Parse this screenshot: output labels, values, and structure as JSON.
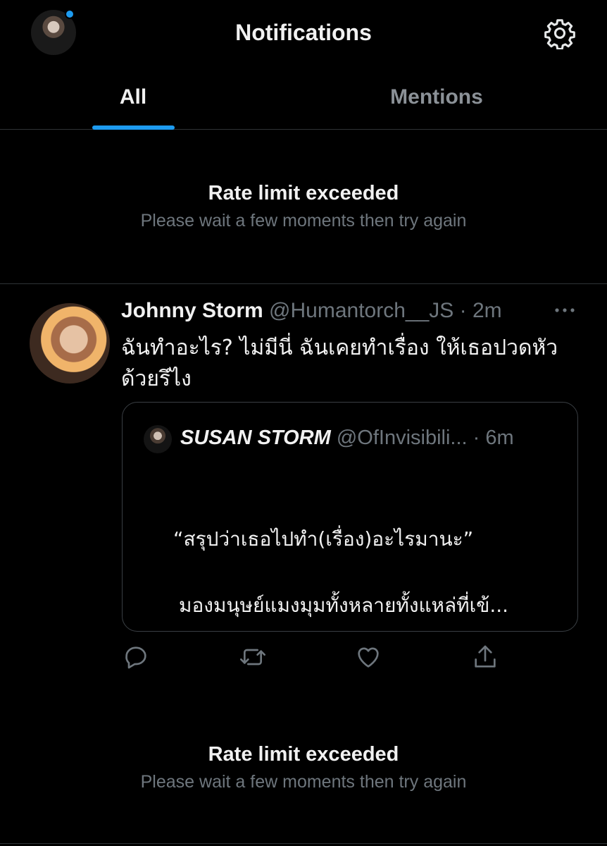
{
  "header": {
    "title": "Notifications",
    "avatar_icon": "profile-avatar",
    "settings_icon": "gear-icon"
  },
  "tabs": [
    {
      "label": "All",
      "selected": true
    },
    {
      "label": "Mentions",
      "selected": false
    }
  ],
  "rate_limit_top": {
    "title": "Rate limit exceeded",
    "subtitle": "Please wait a few moments then try again"
  },
  "tweet": {
    "name": "Johnny Storm",
    "handle": "@Humantorch__JS",
    "time": "· 2m",
    "text": "ฉันทำอะไร? ไม่มีนี่ ฉันเคยทำเรื่อง ให้เธอปวดหัวด้วยรึไง",
    "quote": {
      "name": "SUSAN STORM",
      "handle": "@OfInvisibili...",
      "time": "· 6m",
      "line1": "“สรุปว่าเธอไปทำ(เรื่อง)อะไรมานะ”",
      "line2": "มองมนุษย์แมงมุมทั้งหลายทั้งแหล่ที่เข้..."
    },
    "actions": [
      "reply-icon",
      "retweet-icon",
      "like-icon",
      "share-icon"
    ]
  },
  "rate_limit_bottom": {
    "title": "Rate limit exceeded",
    "subtitle": "Please wait a few moments then try again"
  },
  "colors": {
    "accent": "#1d9bf0",
    "background": "#000000",
    "muted": "#6e767d",
    "border": "#2f3336"
  }
}
